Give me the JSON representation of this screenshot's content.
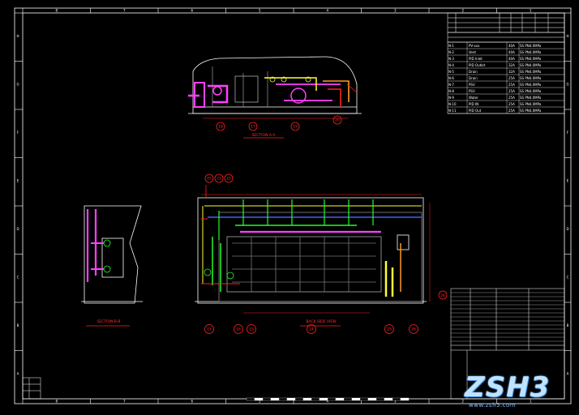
{
  "drawing": {
    "border_numbers_top": [
      "8",
      "7",
      "6",
      "5",
      "4",
      "3",
      "2",
      "1"
    ],
    "border_letters_left": [
      "H",
      "G",
      "F",
      "E",
      "D",
      "C",
      "B",
      "A"
    ],
    "views": {
      "section_a_label": "SECTION A-A",
      "back_side_label": "BACK SIDE VIEW",
      "section_b_label": "SECTION B-B"
    },
    "balloons_top": [
      "18",
      "17",
      "19",
      "20"
    ],
    "balloons_bottom": [
      "17",
      "16",
      "15",
      "24",
      "23",
      "26"
    ],
    "balloons_vertical": [
      "25",
      "21",
      "22"
    ],
    "balloon_right": "26"
  },
  "nozzle_table": {
    "rows": [
      {
        "id": "N-1",
        "desc": "PV-xxx",
        "size": "40A",
        "rating": "SS PN4.0MPa"
      },
      {
        "id": "N-2",
        "desc": "Vent",
        "size": "40A",
        "rating": "SS PN4.0MPa"
      },
      {
        "id": "N-3",
        "desc": "PID Inlet",
        "size": "40A",
        "rating": "SS PN4.0MPa"
      },
      {
        "id": "N-4",
        "desc": "PID Outlet",
        "size": "32A",
        "rating": "SS PN4.0MPa"
      },
      {
        "id": "N-5",
        "desc": "Drain",
        "size": "32A",
        "rating": "SS PN4.0MPa"
      },
      {
        "id": "N-6",
        "desc": "Drain",
        "size": "25A",
        "rating": "SS PN4.0MPa"
      },
      {
        "id": "N-7",
        "desc": "PSV",
        "size": "25A",
        "rating": "SS PN4.0MPa"
      },
      {
        "id": "N-8",
        "desc": "PSV",
        "size": "25A",
        "rating": "SS PN4.0MPa"
      },
      {
        "id": "N-9",
        "desc": "Water",
        "size": "25A",
        "rating": "SS PN4.0MPa"
      },
      {
        "id": "N-10",
        "desc": "PID IN",
        "size": "25A",
        "rating": "SS PN4.0MPa"
      },
      {
        "id": "N-11",
        "desc": "PID Out",
        "size": "25A",
        "rating": "SS PN4.0MPa"
      }
    ]
  },
  "watermark": {
    "logo": "ZSH3",
    "url": "www.zsh3.com"
  },
  "colors": {
    "background": "#000000",
    "frame": "#ffffff",
    "red": "#ff2020",
    "magenta": "#ff40ff",
    "green": "#20ff20",
    "yellow": "#ffff30",
    "cyan": "#30ffff",
    "blue": "#4060ff",
    "orange": "#ff9a20"
  }
}
